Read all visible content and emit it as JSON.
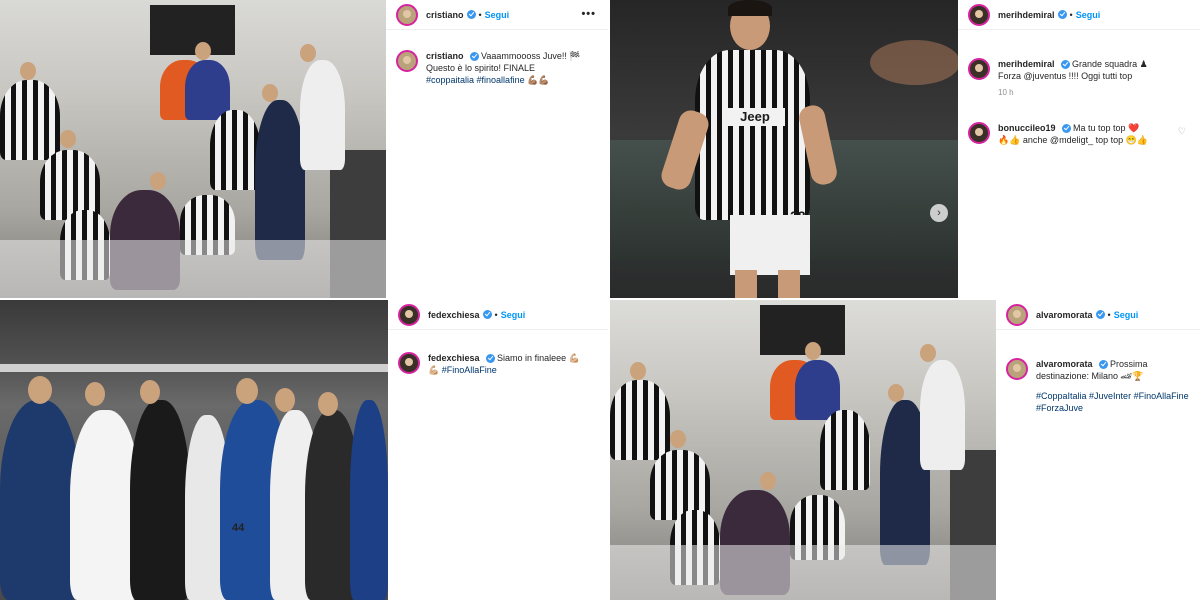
{
  "posts": [
    {
      "username": "cristiano",
      "follow_label": "Segui",
      "more_label": "•••",
      "caption_user": "cristiano",
      "caption_lines": [
        "Vaaammoooss Juve!! 🏁",
        "Questo è lo spirito! FINALE"
      ],
      "hashtags": "#coppaitalia #finoallafine 💪🏽💪🏽"
    },
    {
      "username": "merihdemiral",
      "follow_label": "Segui",
      "more_label": "•••",
      "caption_user": "merihdemiral",
      "caption_lines": [
        "Grande squadra ♟",
        "Forza @juventus !!!! Oggi tutti top"
      ],
      "time": "10 h",
      "reply_user": "bonuccileo19",
      "reply_lines": [
        "Ma tu top top ❤️",
        "🔥👍 anche @mdeligt_ top top 😁👍"
      ],
      "heart_icon": "heart-outline",
      "next_icon": "chevron-right",
      "jersey_sponsor": "Jeep",
      "jersey_number": "28"
    },
    {
      "username": "fedexchiesa",
      "follow_label": "Segui",
      "caption_user": "fedexchiesa",
      "caption_lines": [
        "Siamo in finaleee 💪🏼",
        "💪🏼 #FinoAllaFine"
      ],
      "player_number": "44"
    },
    {
      "username": "alvaromorata",
      "follow_label": "Segui",
      "caption_user": "alvaromorata",
      "caption_lines": [
        "Prossima",
        "destinazione: Milano 🏎🏆"
      ],
      "hashtags_lines": [
        "#CoppaItalia #JuveInter #FinoAllaFine",
        "#ForzaJuve"
      ]
    }
  ],
  "colors": {
    "link": "#0095f6",
    "hashtag": "#00376b",
    "verified": "#3897f0",
    "ring": "#d6249f"
  }
}
